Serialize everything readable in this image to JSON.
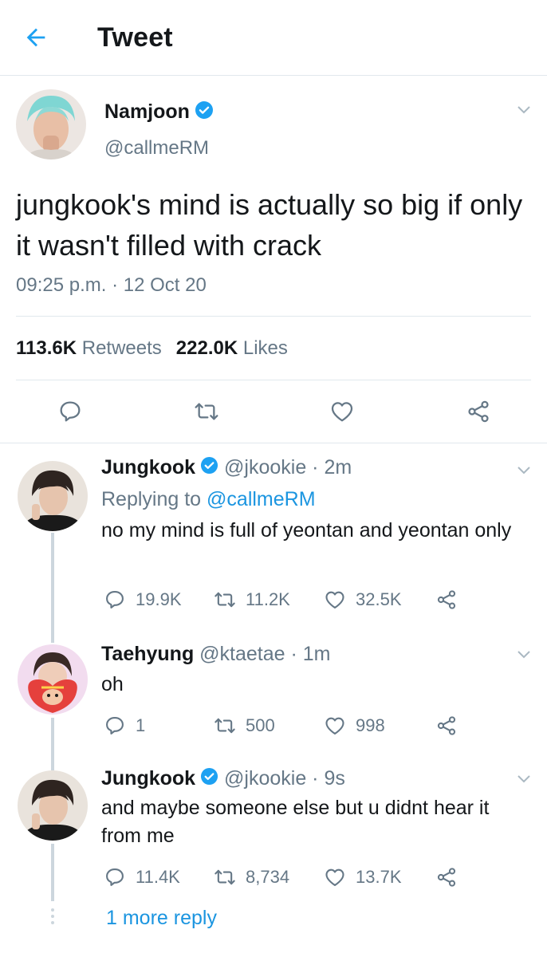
{
  "header": {
    "title": "Tweet"
  },
  "main_tweet": {
    "name": "Namjoon",
    "handle": "@callmeRM",
    "text": "jungkook's mind is actually so big if only it wasn't filled with crack",
    "timestamp": "09:25 p.m. · 12 Oct 20",
    "retweets_count": "113.6K",
    "retweets_label": "Retweets",
    "likes_count": "222.0K",
    "likes_label": "Likes"
  },
  "replies": [
    {
      "name": "Jungkook",
      "meta": "@jkookie · 2m",
      "replying_prefix": "Replying to ",
      "replying_to": "@callmeRM",
      "text": "no my mind is full of yeontan and yeontan only",
      "replies": "19.9K",
      "retweets": "11.2K",
      "likes": "32.5K"
    },
    {
      "name": "Taehyung",
      "meta": "@ktaetae · 1m",
      "text": "oh",
      "replies": "1",
      "retweets": "500",
      "likes": "998"
    },
    {
      "name": "Jungkook",
      "meta": "@jkookie · 9s",
      "text": "and maybe someone else but u didnt hear it from me",
      "replies": "11.4K",
      "retweets": "8,734",
      "likes": "13.7K"
    }
  ],
  "more_replies": "1 more reply",
  "colors": {
    "accent": "#1da1f2",
    "link": "#1b95e0",
    "secondary_text": "#657786",
    "border": "#e1e8ed",
    "thread_line": "#ccd6dd"
  }
}
